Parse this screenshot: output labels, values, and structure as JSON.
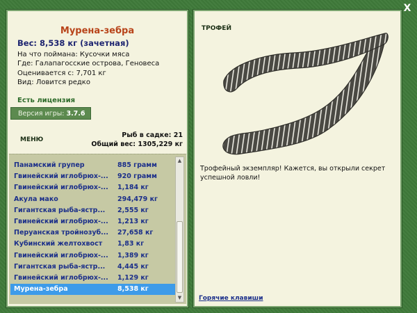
{
  "window": {
    "close_label": "X"
  },
  "fish": {
    "title": "Мурена-зебра",
    "weight_line": "Вес: 8,538 кг (зачетная)",
    "bait": "На что поймана: Кусочки мяса",
    "location": "Где: Галапагосские острова, Геновеса",
    "value": "Оценивается с: 7,701 кг",
    "kind": "Вид: Ловится редко"
  },
  "license_text": "Есть лицензия",
  "version": {
    "label": "Версия игры:",
    "number": "3.7.6"
  },
  "menu_label": "МЕНЮ",
  "stats": {
    "count": "Рыб в садке: 21",
    "total": "Общий вес: 1305,229 кг"
  },
  "catch_list": [
    {
      "name": "Панамский групер",
      "weight": "885 грамм"
    },
    {
      "name": "Гвинейский иглобрюх-...",
      "weight": "920 грамм"
    },
    {
      "name": "Гвинейский иглобрюх-...",
      "weight": "1,184 кг"
    },
    {
      "name": "Акула мако",
      "weight": "294,479 кг"
    },
    {
      "name": "Гигантская рыба-ястр...",
      "weight": "2,555 кг"
    },
    {
      "name": "Гвинейский иглобрюх-...",
      "weight": "1,213 кг"
    },
    {
      "name": "Перуанская тройнозуб...",
      "weight": "27,658 кг"
    },
    {
      "name": "Кубинский желтохвост",
      "weight": "1,83 кг"
    },
    {
      "name": "Гвинейский иглобрюх-...",
      "weight": "1,389 кг"
    },
    {
      "name": "Гигантская рыба-ястр...",
      "weight": "4,445 кг"
    },
    {
      "name": "Гвинейский иглобрюх-...",
      "weight": "1,129 кг"
    },
    {
      "name": "Мурена-зебра",
      "weight": "8,538 кг",
      "selected": true
    }
  ],
  "trophy": {
    "label": "ТРОФЕЙ",
    "text": "Трофейный экземпляр! Кажется, вы открыли секрет успешной ловли!"
  },
  "hotkeys_label": "Горячие клавиши",
  "colors": {
    "background": "#3f7a3a",
    "panel": "#f4f3df",
    "title": "#b8441a",
    "list_text": "#1b2f8a",
    "selection": "#3d9be9"
  }
}
